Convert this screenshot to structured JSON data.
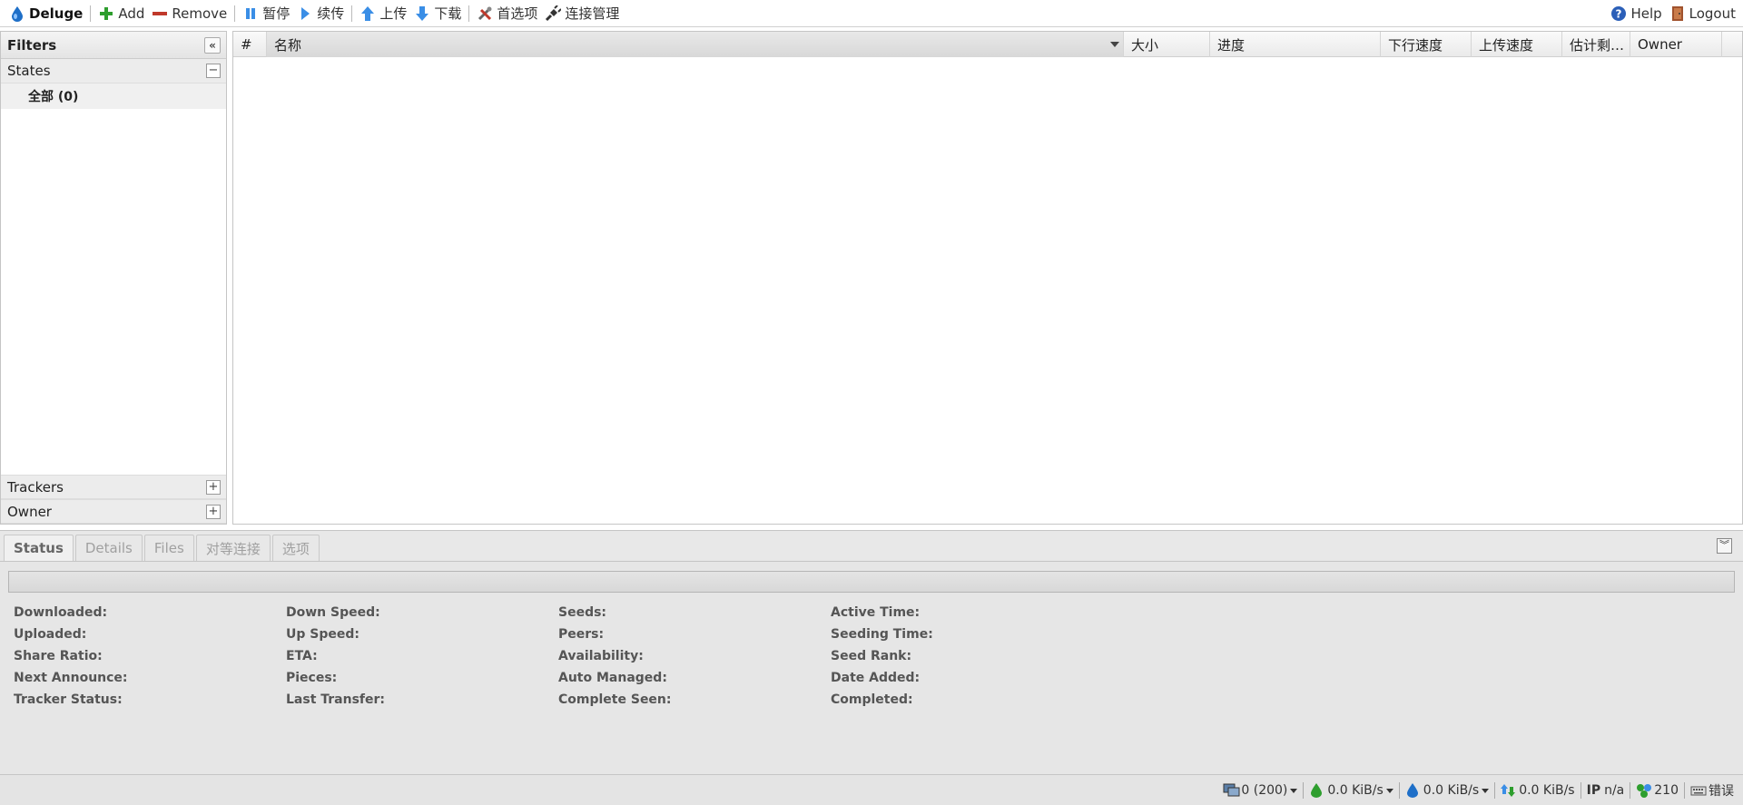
{
  "toolbar": {
    "brand": "Deluge",
    "add": "Add",
    "remove": "Remove",
    "pause": "暂停",
    "resume": "续传",
    "up": "上传",
    "down": "下载",
    "preferences": "首选项",
    "connection_manager": "连接管理",
    "help": "Help",
    "logout": "Logout"
  },
  "filters": {
    "title": "Filters",
    "states_label": "States",
    "all_item": "全部 (0)",
    "trackers_label": "Trackers",
    "owner_label": "Owner"
  },
  "grid": {
    "columns": [
      "#",
      "名称",
      "大小",
      "进度",
      "下行速度",
      "上传速度",
      "估计剩…",
      "Owner"
    ]
  },
  "details": {
    "tabs": [
      "Status",
      "Details",
      "Files",
      "对等连接",
      "选项"
    ],
    "col1": [
      "Downloaded:",
      "Uploaded:",
      "Share Ratio:",
      "Next Announce:",
      "Tracker Status:"
    ],
    "col2": [
      "Down Speed:",
      "Up Speed:",
      "ETA:",
      "Pieces:",
      "Last Transfer:"
    ],
    "col3": [
      "Seeds:",
      "Peers:",
      "Availability:",
      "Auto Managed:",
      "Complete Seen:"
    ],
    "col4": [
      "Active Time:",
      "Seeding Time:",
      "Seed Rank:",
      "Date Added:",
      "Completed:"
    ]
  },
  "statusbar": {
    "connections": "0 (200)",
    "down_speed": "0.0 KiB/s",
    "up_speed": "0.0 KiB/s",
    "protocol": "0.0 KiB/s",
    "ip_label": "IP",
    "ip_value": "n/a",
    "dht": "210",
    "error": "错误"
  },
  "colors": {
    "add_green": "#2e9e2e",
    "remove_red": "#c0392b",
    "deluge_blue": "#1e6fc8",
    "arrow_blue": "#3a8ee6"
  }
}
